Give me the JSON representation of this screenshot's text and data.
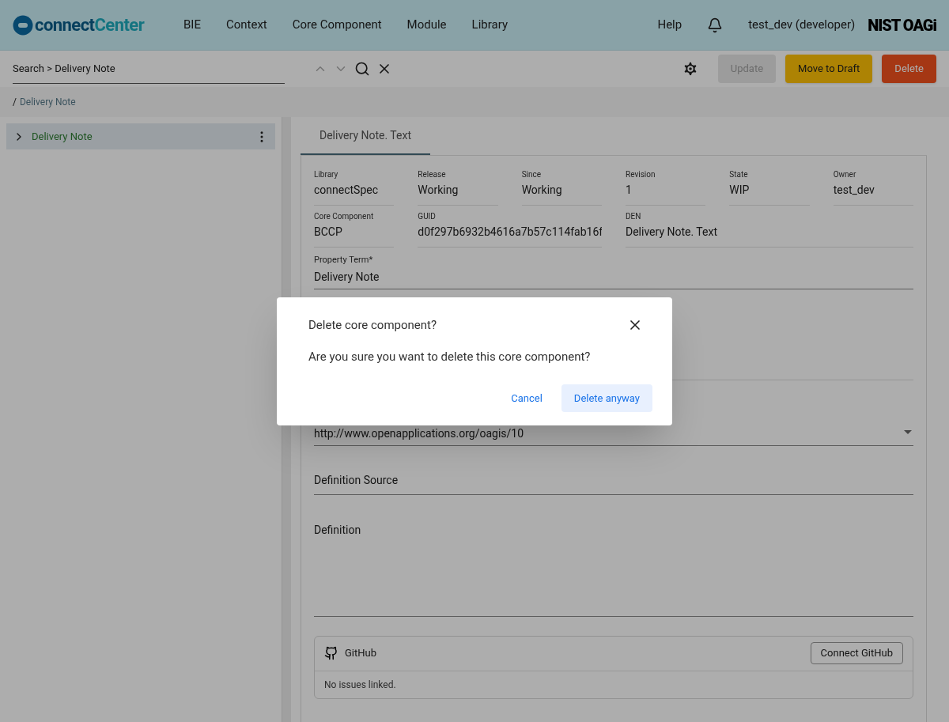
{
  "header": {
    "logo": {
      "first": "connect",
      "second": "Center"
    },
    "nav": [
      "BIE",
      "Context",
      "Core Component",
      "Module",
      "Library"
    ],
    "help": "Help",
    "user": "test_dev (developer)",
    "partner_logo": "NIST OAGi"
  },
  "toolbar": {
    "search": {
      "value": "Search > Delivery Note"
    },
    "buttons": [
      {
        "label": "Update",
        "kind": "disabled"
      },
      {
        "label": "Move to Draft",
        "kind": "warning"
      },
      {
        "label": "Delete",
        "kind": "danger"
      }
    ]
  },
  "breadcrumb": {
    "separator": "/",
    "current": "Delivery Note"
  },
  "tree": [
    {
      "label": "Delivery Note",
      "expanded": false,
      "selected": true
    }
  ],
  "tabs": [
    {
      "label": "Delivery Note. Text",
      "selected": true
    }
  ],
  "fields_row_1": [
    {
      "label": "Library",
      "value": "connectSpec"
    },
    {
      "label": "Release",
      "value": "Working"
    },
    {
      "label": "Since",
      "value": "Working"
    },
    {
      "label": "Revision",
      "value": "1"
    },
    {
      "label": "State",
      "value": "WIP"
    },
    {
      "label": "Owner",
      "value": "test_dev"
    }
  ],
  "fields_row_2": [
    {
      "label": "Core Component",
      "value": "BCCP"
    },
    {
      "label": "GUID",
      "value": "d0f297b6932b4616a7b57c114fab16f"
    },
    {
      "label": "DEN",
      "value": "Delivery Note. Text"
    }
  ],
  "property_term": {
    "label": "Property Term*",
    "value": "Delivery Note"
  },
  "namespace": {
    "value": "http://www.openapplications.org/oagis/10"
  },
  "definition_source": {
    "placeholder": "Definition Source"
  },
  "definition": {
    "placeholder": "Definition"
  },
  "github": {
    "title": "GitHub",
    "button": "Connect GitHub",
    "message": "No issues linked."
  },
  "dialog": {
    "title": "Delete core component?",
    "message": "Are you sure you want to delete this core component?",
    "actions": [
      {
        "label": "Cancel",
        "kind": "text"
      },
      {
        "label": "Delete anyway",
        "kind": "tonal"
      }
    ]
  }
}
